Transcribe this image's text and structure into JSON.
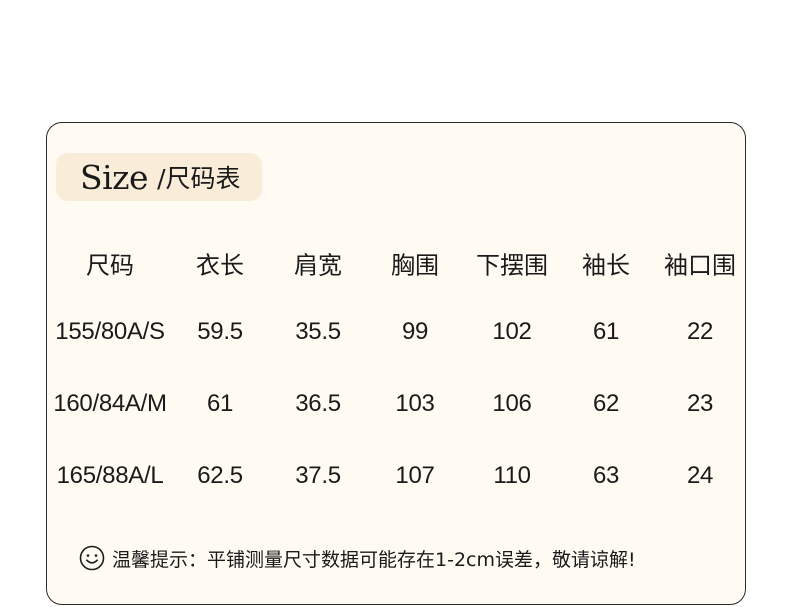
{
  "title": {
    "main": "Size",
    "sub": "/尺码表"
  },
  "table": {
    "headers": [
      "尺码",
      "衣长",
      "肩宽",
      "胸围",
      "下摆围",
      "袖长",
      "袖口围"
    ],
    "rows": [
      [
        "155/80A/S",
        "59.5",
        "35.5",
        "99",
        "102",
        "61",
        "22"
      ],
      [
        "160/84A/M",
        "61",
        "36.5",
        "103",
        "106",
        "62",
        "23"
      ],
      [
        "165/88A/L",
        "62.5",
        "37.5",
        "107",
        "110",
        "63",
        "24"
      ]
    ]
  },
  "note": {
    "icon": "smiley-icon",
    "text": "温馨提示：平铺测量尺寸数据可能存在1-2cm误差，敬请谅解!"
  },
  "colors": {
    "card_background": "#fffbf3",
    "title_pill": "#f9ecd9",
    "border": "#2a2a2a",
    "text": "#1a1a1a"
  }
}
